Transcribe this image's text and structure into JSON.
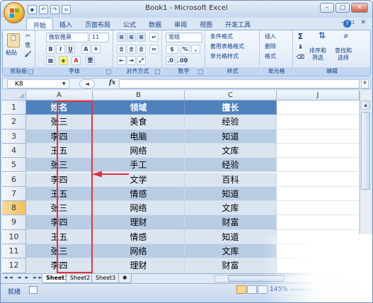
{
  "window": {
    "title": "Book1 - Microsoft Excel",
    "controls": {
      "minimize": "–",
      "restore": "▢",
      "close": "✕"
    }
  },
  "quick_access": {
    "save_icon": "floppy-icon",
    "undo_icon": "undo-icon",
    "redo_icon": "redo-icon",
    "customize": "="
  },
  "tabs": [
    "开始",
    "插入",
    "页面布局",
    "公式",
    "数据",
    "审阅",
    "视图",
    "开发工具"
  ],
  "active_tab": "开始",
  "ribbon": {
    "clipboard": {
      "label": "剪贴板",
      "paste": "粘贴"
    },
    "font": {
      "label": "字体",
      "name": "微软雅黑",
      "size": "11",
      "bold": "B",
      "italic": "I",
      "underline": "U",
      "grow": "A",
      "shrink": "A",
      "phonetic": "雯"
    },
    "alignment": {
      "label": "对齐方式"
    },
    "number": {
      "label": "数字",
      "format": "常规",
      "percent": "%",
      "comma": ","
    },
    "styles": {
      "label": "样式",
      "conditional": "条件格式",
      "table_format": "套用表格格式",
      "cell_styles": "单元格样式"
    },
    "cells": {
      "label": "单元格",
      "insert": "插入",
      "delete": "删除",
      "format": "格式"
    },
    "editing": {
      "label": "编辑",
      "sort_filter": "排序和\n筛选",
      "find_select": "查找和\n选择",
      "sigma": "Σ"
    }
  },
  "formula_bar": {
    "name_box": "K8",
    "fx": "fx",
    "formula": ""
  },
  "columns": [
    "A",
    "B",
    "C",
    "J"
  ],
  "rows": [
    "1",
    "2",
    "3",
    "4",
    "5",
    "6",
    "7",
    "8",
    "9",
    "10",
    "11",
    "12"
  ],
  "selected_row": "8",
  "table": {
    "headers": [
      "姓名",
      "领域",
      "擅长"
    ],
    "rows": [
      [
        "张三",
        "美食",
        "经验"
      ],
      [
        "李四",
        "电脑",
        "知道"
      ],
      [
        "王五",
        "网络",
        "文库"
      ],
      [
        "张三",
        "手工",
        "经验"
      ],
      [
        "李四",
        "文学",
        "百科"
      ],
      [
        "王五",
        "情感",
        "知道"
      ],
      [
        "张三",
        "网络",
        "文库"
      ],
      [
        "李四",
        "理财",
        "财富"
      ],
      [
        "王五",
        "情感",
        "知道"
      ],
      [
        "张三",
        "网络",
        "文库"
      ],
      [
        "李四",
        "理财",
        "财富"
      ]
    ]
  },
  "colors": {
    "header_fill": "#4f81bd",
    "band_light": "#dbe5f1",
    "band_dark": "#b8cce4",
    "annotation": "#e8323c"
  },
  "sheet_tabs": [
    "Sheet1",
    "Sheet2",
    "Sheet3"
  ],
  "active_sheet": "Sheet1",
  "status": {
    "ready": "就绪",
    "zoom": "145%"
  }
}
